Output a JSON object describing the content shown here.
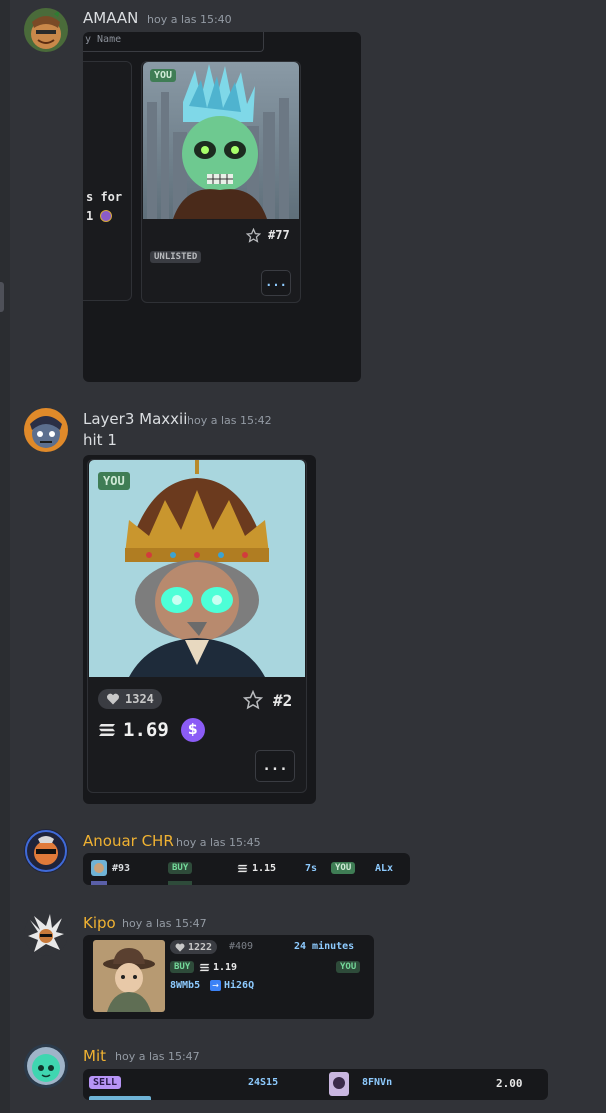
{
  "messages": [
    {
      "author": "AMAAN",
      "author_color": "#dbdee1",
      "timestamp": "hoy a las 15:40",
      "embed": {
        "search_placeholder_partial": "y Name",
        "left_card_text_1": "s for",
        "left_card_text_2": "1",
        "you_badge": "YOU",
        "nft_number": "#77",
        "status": "UNLISTED",
        "menu_label": "..."
      }
    },
    {
      "author": "Layer3 Maxxii",
      "author_color": "#dbdee1",
      "timestamp": "hoy a las 15:42",
      "text": "hit 1",
      "embed": {
        "you_badge": "YOU",
        "likes": "1324",
        "nft_number": "#2",
        "price": "1.69",
        "currency_icon": "dollar-icon",
        "menu_label": "..."
      }
    },
    {
      "author": "Anouar CHR",
      "author_color": "#f0b232",
      "timestamp": "hoy a las 15:45",
      "trade": {
        "nft_number": "#93",
        "action": "BUY",
        "price": "1.15",
        "age": "7s",
        "you_badge": "YOU",
        "user": "ALx"
      }
    },
    {
      "author": "Kipo",
      "author_color": "#f0b232",
      "timestamp": "hoy a las 15:47",
      "trade": {
        "likes": "1222",
        "nft_number": "#409",
        "age": "24 minutes",
        "action": "BUY",
        "price": "1.19",
        "you_badge": "YOU",
        "from": "8WMb5",
        "to": "Hi26Q"
      }
    },
    {
      "author": "Mit",
      "author_color": "#f0b232",
      "timestamp": "hoy a las 15:47",
      "trade": {
        "action": "SELL",
        "code": "24S15",
        "user": "8FNVn",
        "price": "2.00"
      }
    }
  ],
  "colors": {
    "background": "#313338",
    "embed_bg": "#17181b",
    "you_green": "#3f7d55",
    "accent_blue": "#8ecbff",
    "gold_name": "#f0b232",
    "sell_purple": "#b794f6"
  }
}
